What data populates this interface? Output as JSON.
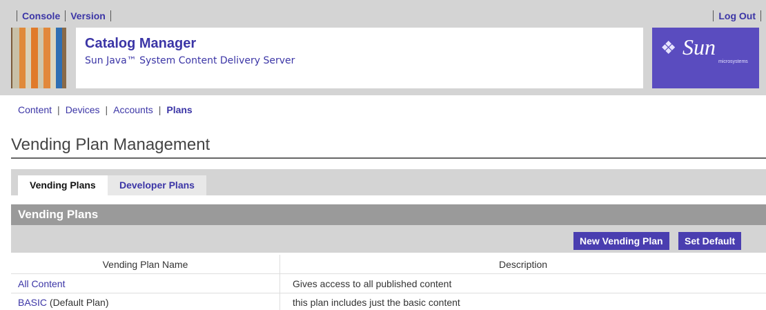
{
  "top_links": [
    "Console",
    "Version"
  ],
  "logout": "Log Out",
  "masthead": {
    "title": "Catalog Manager",
    "subtitle": "Sun Java™ System Content Delivery Server",
    "logo_word": "Sun",
    "logo_sub": "microsystems"
  },
  "nav": [
    "Content",
    "Devices",
    "Accounts",
    "Plans"
  ],
  "page_title": "Vending Plan Management",
  "tabs": [
    {
      "label": "Vending Plans",
      "active": true
    },
    {
      "label": "Developer Plans",
      "active": false
    }
  ],
  "section_title": "Vending Plans",
  "buttons": {
    "new": "New Vending Plan",
    "set_default": "Set Default"
  },
  "table": {
    "headers": [
      "Vending Plan Name",
      "Description"
    ],
    "rows": [
      {
        "name": "All Content",
        "suffix": "",
        "description": "Gives access to all published content"
      },
      {
        "name": "BASIC",
        "suffix": " (Default Plan)",
        "description": "this plan includes just the basic content"
      }
    ]
  },
  "colors": {
    "accent": "#3b35a6",
    "button": "#4a3eb0",
    "logo_bg": "#5a4cbf",
    "chrome": "#d4d4d4"
  }
}
